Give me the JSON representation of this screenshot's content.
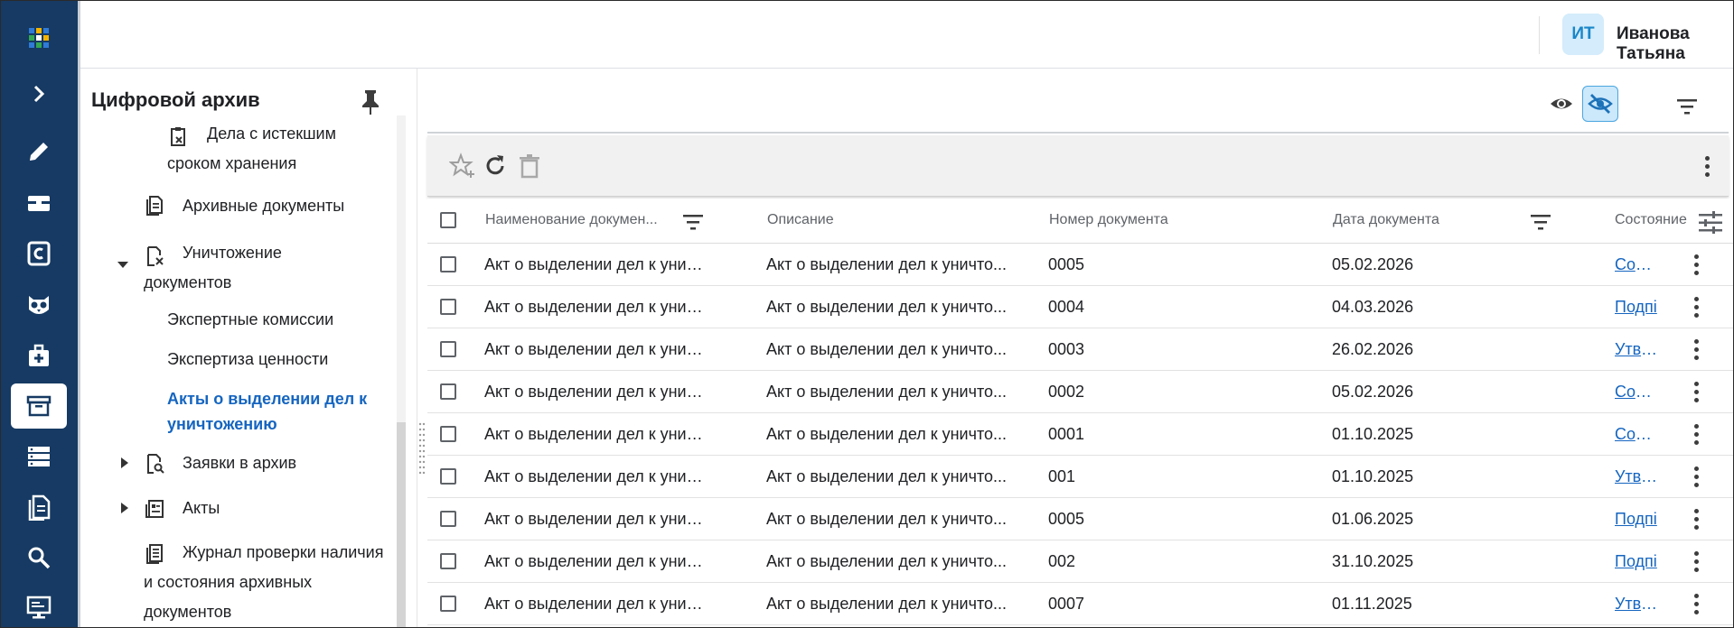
{
  "rail": {
    "items": [
      {
        "icon": "apps-grid-icon"
      },
      {
        "icon": "expand-chevron-icon"
      },
      {
        "icon": "pencil-icon"
      },
      {
        "icon": "inbox-icon"
      },
      {
        "icon": "c-letter-icon"
      },
      {
        "icon": "owl-icon"
      },
      {
        "icon": "medical-case-icon"
      },
      {
        "icon": "archive-icon",
        "active": true
      },
      {
        "icon": "server-icon"
      },
      {
        "icon": "documents-icon"
      },
      {
        "icon": "search-icon"
      },
      {
        "icon": "monitor-icon"
      }
    ],
    "bg_color": "#163a63"
  },
  "header": {
    "avatar_initials": "ИТ",
    "user_name": "Иванова Татьяна"
  },
  "sidebar": {
    "title": "Цифровой архив",
    "items": [
      {
        "label": "Дела с истекшим сроком хранения",
        "icon": "expired-cases-icon"
      },
      {
        "label": "Архивные документы",
        "icon": "document-icon"
      },
      {
        "label": "Уничтожение документов",
        "icon": "document-delete-icon",
        "expanded": true
      },
      {
        "label": "Экспертные комиссии"
      },
      {
        "label": "Экспертиза ценности"
      },
      {
        "label": "Акты о выделении дел к уничтожению",
        "active": true
      },
      {
        "label": "Заявки в архив",
        "icon": "document-search-icon",
        "collapsed": true
      },
      {
        "label": "Акты",
        "icon": "newspaper-icon",
        "collapsed": true
      },
      {
        "label": "Журнал проверки наличия и состояния архивных документов",
        "icon": "journal-icon"
      }
    ]
  },
  "table": {
    "columns": [
      "Наименование докумен...",
      "Описание",
      "Номер документа",
      "Дата документа",
      "Состояние"
    ],
    "rows": [
      {
        "name": "Акт о выделении дел к уничто...",
        "description": "Акт о выделении дел к уничто...",
        "number": "0005",
        "date": "05.02.2026",
        "state": "Созда"
      },
      {
        "name": "Акт о выделении дел к уничто...",
        "description": "Акт о выделении дел к уничто...",
        "number": "0004",
        "date": "04.03.2026",
        "state": "Подпі"
      },
      {
        "name": "Акт о выделении дел к уничто...",
        "description": "Акт о выделении дел к уничто...",
        "number": "0003",
        "date": "26.02.2026",
        "state": "Утвер"
      },
      {
        "name": "Акт о выделении дел к уничто...",
        "description": "Акт о выделении дел к уничто...",
        "number": "0002",
        "date": "05.02.2026",
        "state": "Созда"
      },
      {
        "name": "Акт о выделении дел к уничто...",
        "description": "Акт о выделении дел к уничто...",
        "number": "0001",
        "date": "01.10.2025",
        "state": "Созда"
      },
      {
        "name": "Акт о выделении дел к уничто...",
        "description": "Акт о выделении дел к уничто...",
        "number": "001",
        "date": "01.10.2025",
        "state": "Утвер"
      },
      {
        "name": "Акт о выделении дел к уничто...",
        "description": "Акт о выделении дел к уничто...",
        "number": "0005",
        "date": "01.06.2025",
        "state": "Подпі"
      },
      {
        "name": "Акт о выделении дел к уничто...",
        "description": "Акт о выделении дел к уничто...",
        "number": "002",
        "date": "31.10.2025",
        "state": "Подпі"
      },
      {
        "name": "Акт о выделении дел к уничто...",
        "description": "Акт о выделении дел к уничто...",
        "number": "0007",
        "date": "01.11.2025",
        "state": "Утвер"
      }
    ]
  },
  "colors": {
    "accent": "#1565c0",
    "avatar_bg": "#d4ecfb",
    "toggle_active_bg": "#cce8fb"
  }
}
